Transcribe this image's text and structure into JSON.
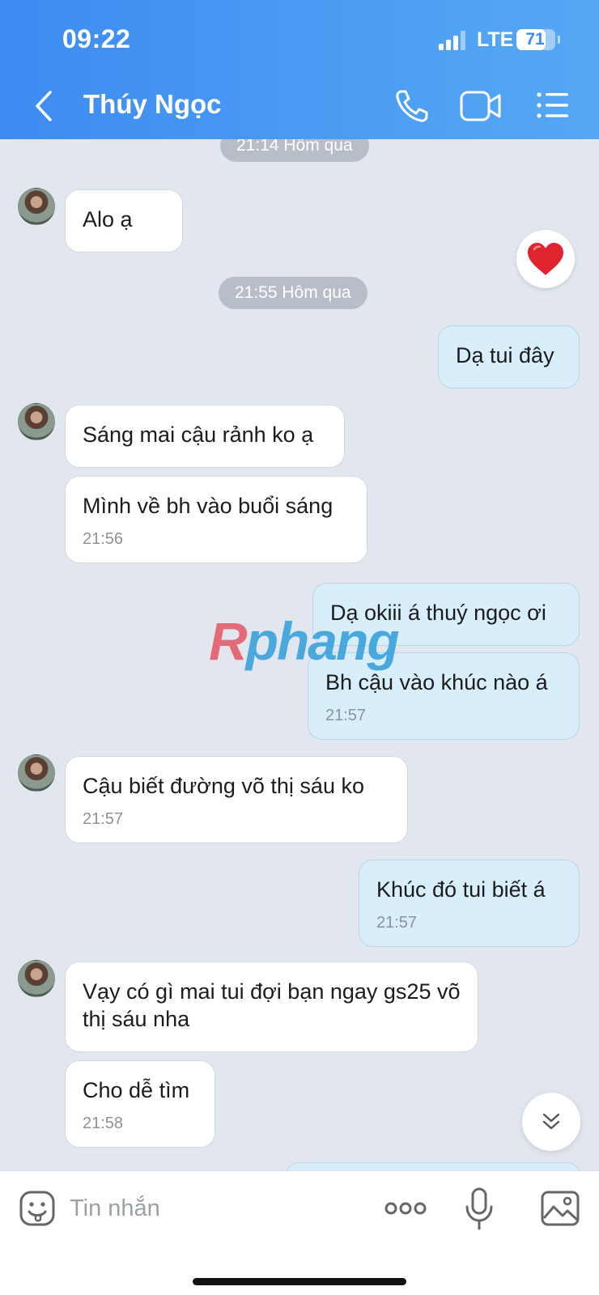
{
  "status_bar": {
    "time": "09:22",
    "network": "LTE",
    "battery": "71"
  },
  "header": {
    "contact_name": "Thúy Ngọc",
    "icons": [
      "chevron-left-icon",
      "phone-icon",
      "video-icon",
      "list-menu-icon"
    ]
  },
  "colors": {
    "header_start": "#3d8bf2",
    "header_end": "#56a8f4",
    "chat_bg": "#e2e7ef",
    "outgoing_bubble": "#d9eefb",
    "incoming_bubble": "#ffffff",
    "heart": "#e0242f"
  },
  "chat": {
    "time_dividers": [
      "21:14 Hôm qua",
      "21:55 Hôm qua"
    ],
    "messages": [
      {
        "direction": "in",
        "text": "Alo ạ",
        "time": ""
      },
      {
        "direction": "out",
        "text": "Dạ tui đây",
        "time": ""
      },
      {
        "direction": "in",
        "text": "Sáng mai cậu rảnh ko ạ",
        "time": ""
      },
      {
        "direction": "in",
        "text": "Mình về bh vào buổi sáng",
        "time": "21:56"
      },
      {
        "direction": "out",
        "text": "Dạ okiii á thuý ngọc ơi",
        "time": ""
      },
      {
        "direction": "out",
        "text": "Bh cậu vào khúc nào á",
        "time": "21:57"
      },
      {
        "direction": "in",
        "text": "Cậu biết đường võ thị sáu ko",
        "time": "21:57"
      },
      {
        "direction": "out",
        "text": "Khúc đó tui biết á",
        "time": "21:57"
      },
      {
        "direction": "in",
        "text": "Vạy có gì mai tui đợi bạn ngay gs25 võ thị sáu nha",
        "time": ""
      },
      {
        "direction": "in",
        "text": "Cho dễ tìm",
        "time": "21:58"
      }
    ],
    "reaction": "heart-icon",
    "watermark": {
      "r": "R",
      "rest": "phang"
    }
  },
  "input_bar": {
    "placeholder": "Tin nhắn",
    "icons": [
      "emoji-icon",
      "more-dots-icon",
      "microphone-icon",
      "image-icon"
    ]
  }
}
